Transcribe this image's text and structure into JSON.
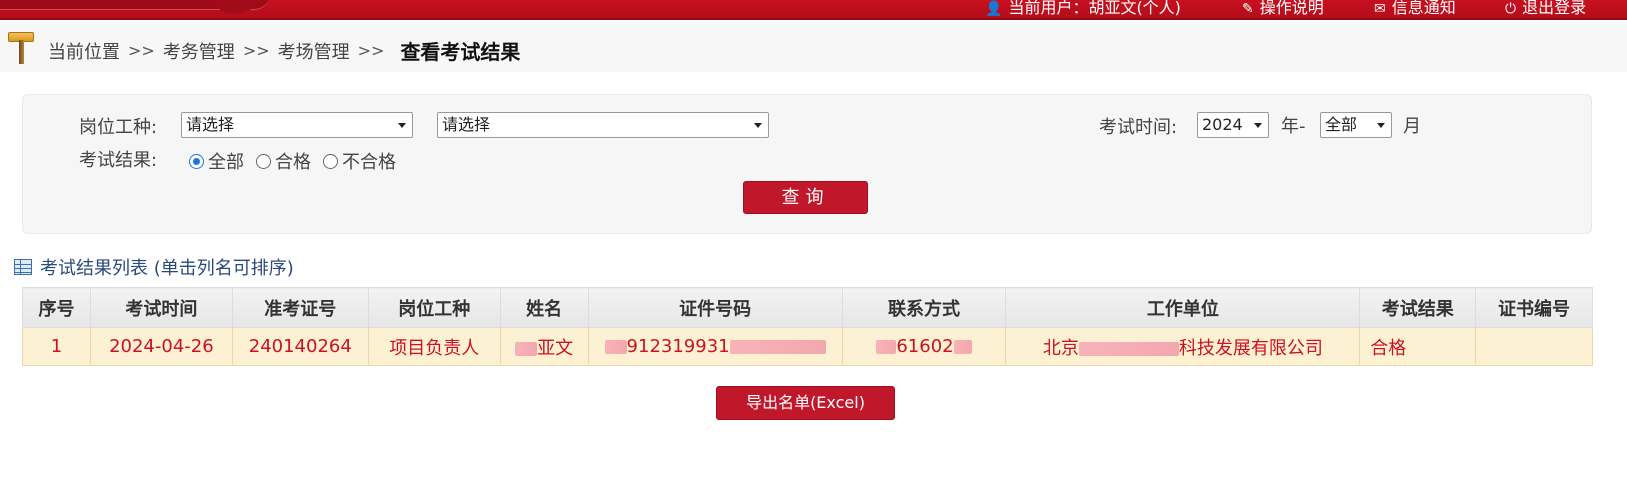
{
  "header": {
    "current_user": "当前用户：胡亚文(个人)",
    "help": "操作说明",
    "notice": "信息通知",
    "logout": "退出登录"
  },
  "breadcrumb": {
    "items": [
      "当前位置",
      "考务管理",
      "考场管理"
    ],
    "separator": ">>",
    "current": "查看考试结果"
  },
  "filter": {
    "position_label": "岗位工种:",
    "position_select_1": "请选择",
    "position_select_2": "请选择",
    "exam_time_label": "考试时间:",
    "year_value": "2024",
    "year_suffix": "年-",
    "month_value": "全部",
    "month_suffix": "月",
    "result_label": "考试结果:",
    "result_options": [
      "全部",
      "合格",
      "不合格"
    ],
    "result_selected": "全部",
    "query_button": "查询"
  },
  "list": {
    "title": "考试结果列表 (单击列名可排序)",
    "columns": [
      "序号",
      "考试时间",
      "准考证号",
      "岗位工种",
      "姓名",
      "证件号码",
      "联系方式",
      "工作单位",
      "考试结果",
      "证书编号"
    ],
    "rows": [
      {
        "index": "1",
        "exam_time": "2024-04-26",
        "ticket_no": "240140264",
        "position": "项目负责人",
        "name": "亚文",
        "id_no": "912319931",
        "contact": "61602",
        "company_start": "北京",
        "company_end": "科技发展有限公司",
        "result": "合格",
        "cert_no": ""
      }
    ]
  },
  "export_button": "导出名单(Excel)",
  "colors": {
    "header_red": "#c8101f",
    "button_red": "#c0182a",
    "row_highlight": "#fdf1d3",
    "link_blue": "#2b4a7a"
  }
}
